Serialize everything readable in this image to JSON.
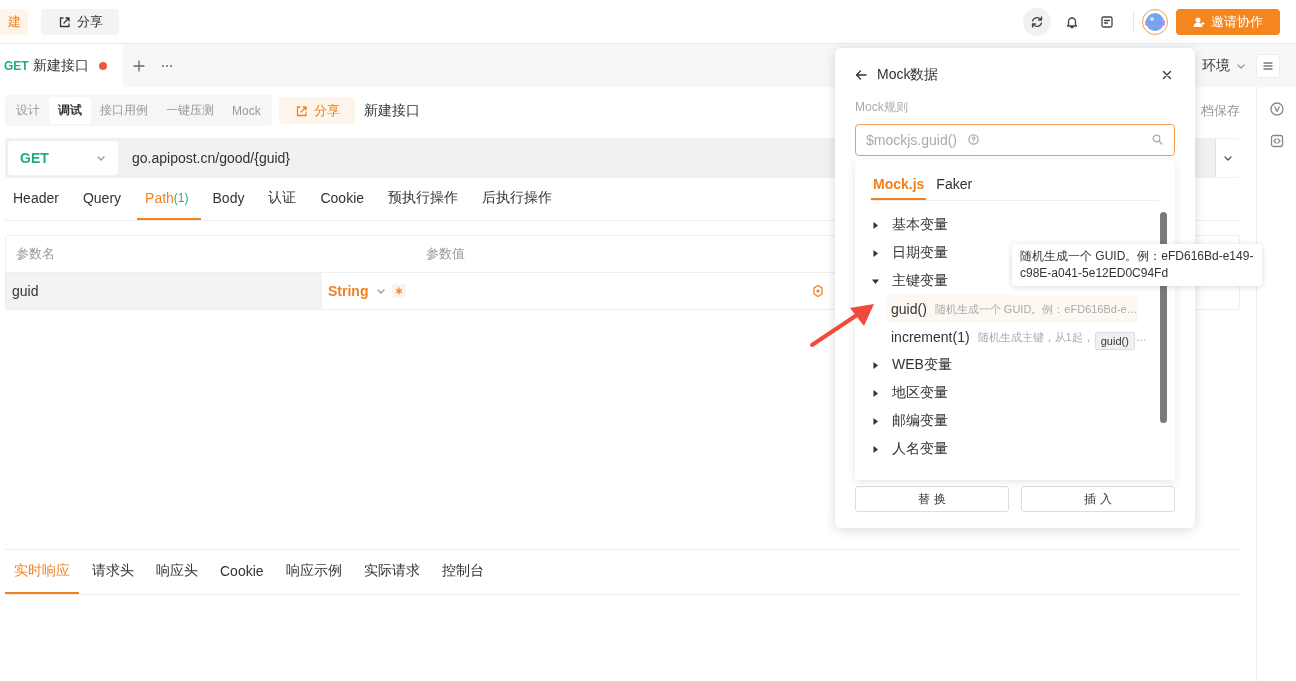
{
  "topbar": {
    "new_button": "建",
    "share_button": "分享",
    "invite_button": "邀请协作"
  },
  "request_tabs": [
    {
      "method": "GET",
      "title": "新建接口",
      "unsaved": true,
      "selected": true
    }
  ],
  "environment": "环境",
  "mode_tabs": [
    {
      "label": "设计",
      "selected": false
    },
    {
      "label": "调试",
      "selected": true
    },
    {
      "label": "接口用例",
      "selected": false
    },
    {
      "label": "一键压测",
      "selected": false
    },
    {
      "label": "Mock",
      "selected": false
    }
  ],
  "share_button": "分享",
  "api_name": "新建接口",
  "save_label": "档保存",
  "method": "GET",
  "url": "go.apipost.cn/good/{guid}",
  "param_tabs": [
    {
      "label": "Header",
      "selected": false
    },
    {
      "label": "Query",
      "selected": false
    },
    {
      "label": "Path",
      "count": "(1)",
      "selected": true
    },
    {
      "label": "Body",
      "selected": false
    },
    {
      "label": "认证",
      "selected": false
    },
    {
      "label": "Cookie",
      "selected": false
    },
    {
      "label": "预执行操作",
      "selected": false
    },
    {
      "label": "后执行操作",
      "selected": false
    }
  ],
  "params_table": {
    "columns": [
      "参数名",
      "参数值"
    ],
    "rows": [
      {
        "name": "guid",
        "type": "String",
        "required": true
      }
    ]
  },
  "response_tabs": [
    {
      "label": "实时响应",
      "selected": true
    },
    {
      "label": "请求头",
      "selected": false
    },
    {
      "label": "响应头",
      "selected": false
    },
    {
      "label": "Cookie",
      "selected": false
    },
    {
      "label": "响应示例",
      "selected": false
    },
    {
      "label": "实际请求",
      "selected": false
    },
    {
      "label": "控制台",
      "selected": false
    }
  ],
  "mock_panel": {
    "title": "Mock数据",
    "rule_label": "Mock规则",
    "placeholder": "$mockjs.guid()",
    "tabs": [
      {
        "label": "Mock.js",
        "selected": true
      },
      {
        "label": "Faker",
        "selected": false
      }
    ],
    "tree": [
      {
        "label": "基本变量",
        "expanded": false
      },
      {
        "label": "日期变量",
        "expanded": false
      },
      {
        "label": "主键变量",
        "expanded": true,
        "children": [
          {
            "label": "guid()",
            "description": "随机生成一个 GUID。例：eFD616Bd-e…",
            "selected": true
          },
          {
            "label": "increment(1)",
            "description": "随机生成主键，从1起，",
            "more": "…",
            "selected": false
          }
        ]
      },
      {
        "label": "WEB变量",
        "expanded": false
      },
      {
        "label": "地区变量",
        "expanded": false
      },
      {
        "label": "邮编变量",
        "expanded": false
      },
      {
        "label": "人名变量",
        "expanded": false
      }
    ],
    "tooltip": "随机生成一个 GUID。例：eFD616Bd-e149-c98E-a041-5e12ED0C94Fd",
    "hint": "guid()",
    "buttons": [
      "替 换",
      "插 入"
    ]
  }
}
